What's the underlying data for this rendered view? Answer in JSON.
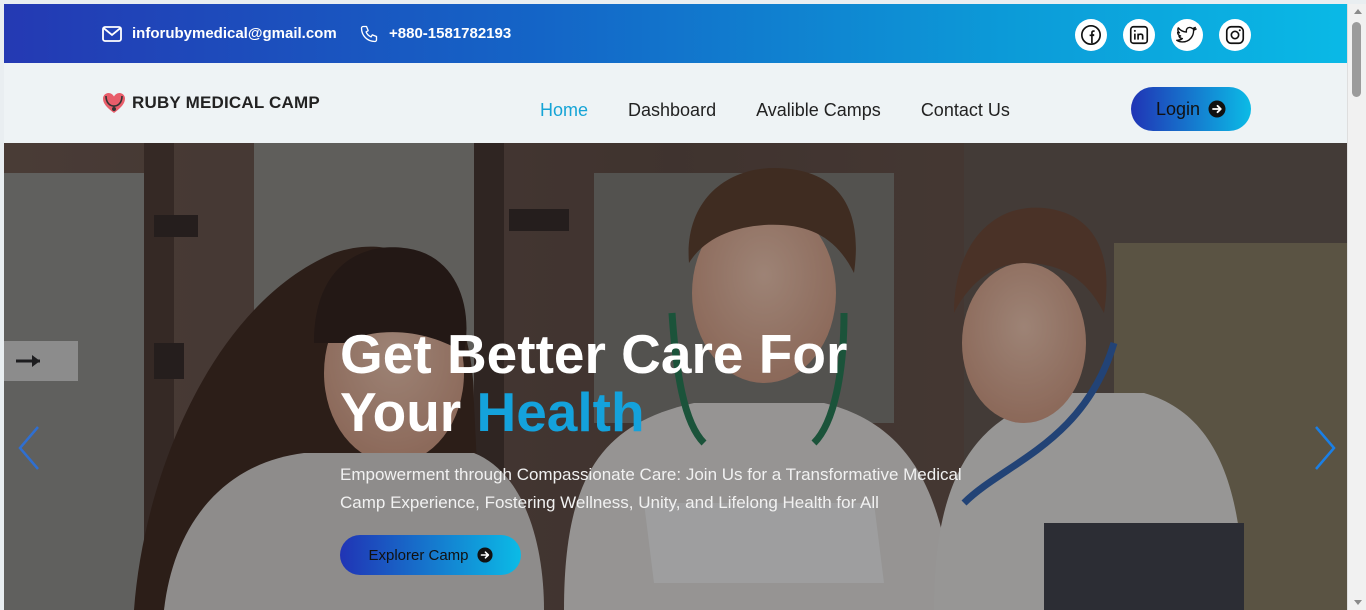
{
  "topbar": {
    "email": "inforubymedical@gmail.com",
    "phone": "+880-1581782193",
    "socials": [
      "facebook-icon",
      "linkedin-icon",
      "twitter-icon",
      "instagram-icon"
    ]
  },
  "brand": {
    "name": "RUBY MEDICAL CAMP"
  },
  "nav": {
    "items": [
      {
        "label": "Home",
        "active": true
      },
      {
        "label": "Dashboard",
        "active": false
      },
      {
        "label": "Avalible Camps",
        "active": false
      },
      {
        "label": "Contact Us",
        "active": false
      }
    ],
    "login_label": "Login"
  },
  "hero": {
    "title_line1": "Get Better Care For",
    "title_line2_plain": "Your",
    "title_line2_accent": "Health",
    "description": "Empowerment through Compassionate Care: Join Us for a Transformative Medical Camp Experience, Fostering Wellness, Unity, and Lifelong Health for All",
    "cta_label": "Explorer Camp"
  },
  "colors": {
    "accent": "#14a2dc",
    "gradient_start": "#2034b5",
    "gradient_end": "#0bbbe6"
  }
}
